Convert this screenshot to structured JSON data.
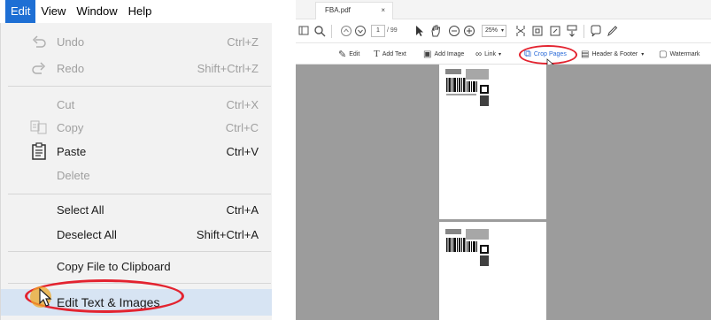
{
  "menubar": {
    "items": [
      "Edit",
      "View",
      "Window",
      "Help"
    ]
  },
  "edit_menu": {
    "undo": {
      "label": "Undo",
      "shortcut": "Ctrl+Z"
    },
    "redo": {
      "label": "Redo",
      "shortcut": "Shift+Ctrl+Z"
    },
    "cut": {
      "label": "Cut",
      "shortcut": "Ctrl+X"
    },
    "copy": {
      "label": "Copy",
      "shortcut": "Ctrl+C"
    },
    "paste": {
      "label": "Paste",
      "shortcut": "Ctrl+V"
    },
    "delete": {
      "label": "Delete"
    },
    "select_all": {
      "label": "Select All",
      "shortcut": "Ctrl+A"
    },
    "deselect_all": {
      "label": "Deselect All",
      "shortcut": "Shift+Ctrl+A"
    },
    "copy_file": {
      "label": "Copy File to Clipboard"
    },
    "edit_text_images": {
      "label": "Edit Text & Images"
    }
  },
  "acrobat": {
    "tab": {
      "title": "FBA.pdf",
      "close": "×"
    },
    "toolbar": {
      "page_current": "1",
      "page_total": "/ 99",
      "zoom": "25%"
    },
    "edit_toolbar": {
      "edit": "Edit",
      "add_text": "Add Text",
      "add_image": "Add Image",
      "link": "Link",
      "crop_pages": "Crop Pages",
      "header_footer": "Header & Footer",
      "watermark": "Watermark"
    }
  },
  "colors": {
    "menu_highlight": "#1e6fd4",
    "annotation_red": "#e3232f",
    "viewer_bg": "#9c9c9c"
  }
}
